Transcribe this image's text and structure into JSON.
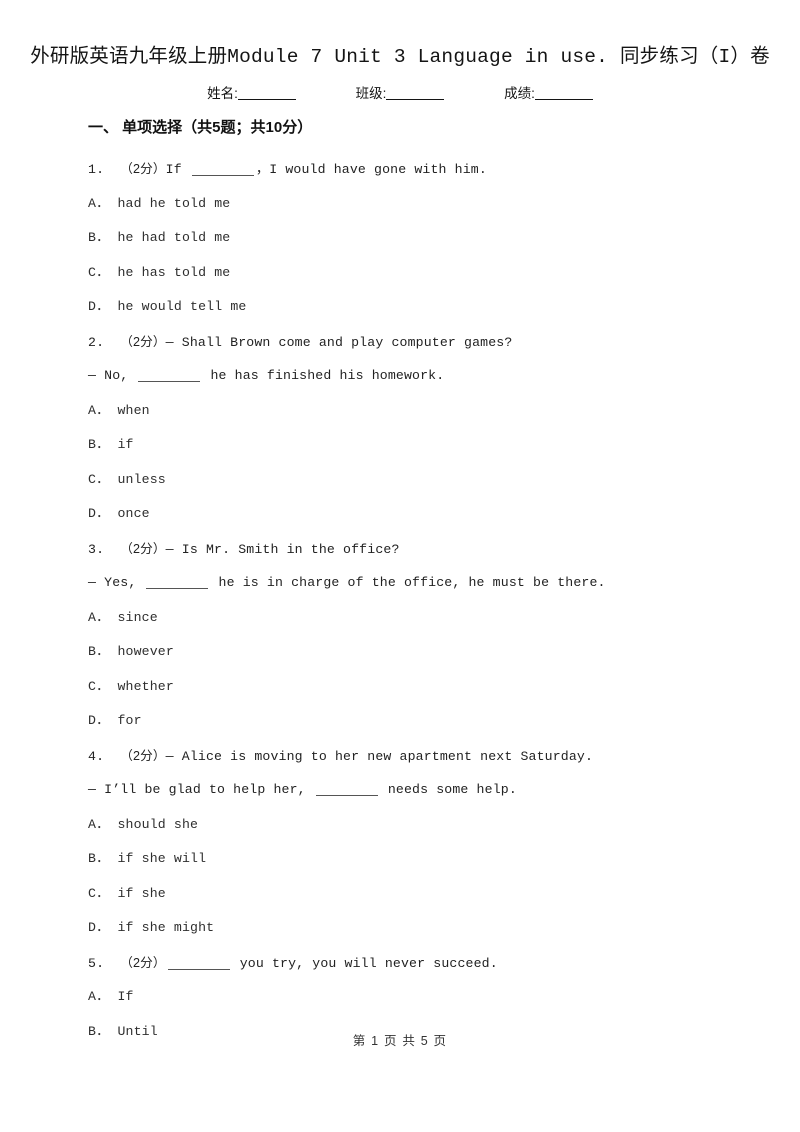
{
  "document": {
    "title": "外研版英语九年级上册Module 7 Unit 3 Language in use. 同步练习（I）卷",
    "meta": {
      "name_label": "姓名:",
      "class_label": "班级:",
      "score_label": "成绩:"
    },
    "footer": "第 1 页 共 5 页"
  },
  "section": {
    "header": "一、 单项选择（共5题；共10分）"
  },
  "questions": [
    {
      "number": "1.",
      "points": "（2分）",
      "stem_lines": [
        {
          "text_before": "If ",
          "blank": true,
          "text_after": "，I would have gone with him."
        }
      ],
      "options": [
        {
          "label": "A．",
          "text": "had he told me"
        },
        {
          "label": "B．",
          "text": "he had told me"
        },
        {
          "label": "C．",
          "text": "he has told me"
        },
        {
          "label": "D．",
          "text": "he would tell me"
        }
      ]
    },
    {
      "number": "2.",
      "points": "（2分）",
      "stem_lines": [
        {
          "text_before": "— Shall Brown come and play computer games?",
          "blank": false,
          "text_after": ""
        },
        {
          "text_before": "— No, ",
          "blank": true,
          "text_after": " he has finished his homework."
        }
      ],
      "options": [
        {
          "label": "A．",
          "text": "when"
        },
        {
          "label": "B．",
          "text": "if"
        },
        {
          "label": "C．",
          "text": "unless"
        },
        {
          "label": "D．",
          "text": "once"
        }
      ]
    },
    {
      "number": "3.",
      "points": "（2分）",
      "stem_lines": [
        {
          "text_before": "— Is Mr. Smith in the office?",
          "blank": false,
          "text_after": ""
        },
        {
          "text_before": "— Yes, ",
          "blank": true,
          "text_after": " he is in charge of the office, he must be there."
        }
      ],
      "options": [
        {
          "label": "A．",
          "text": "since"
        },
        {
          "label": "B．",
          "text": "however"
        },
        {
          "label": "C．",
          "text": "whether"
        },
        {
          "label": "D．",
          "text": "for"
        }
      ]
    },
    {
      "number": "4.",
      "points": "（2分）",
      "stem_lines": [
        {
          "text_before": "— Alice is moving to her new apartment next Saturday.",
          "blank": false,
          "text_after": ""
        },
        {
          "text_before": "— I’ll be glad to help her, ",
          "blank": true,
          "text_after": " needs some help."
        }
      ],
      "options": [
        {
          "label": "A．",
          "text": "should she"
        },
        {
          "label": "B．",
          "text": "if she will"
        },
        {
          "label": "C．",
          "text": "if she"
        },
        {
          "label": "D．",
          "text": "if she might"
        }
      ]
    },
    {
      "number": "5.",
      "points": "（2分）",
      "stem_lines": [
        {
          "text_before": "",
          "blank": true,
          "text_after": " you try, you will never succeed."
        }
      ],
      "options": [
        {
          "label": "A．",
          "text": "If"
        },
        {
          "label": "B．",
          "text": "Until"
        }
      ]
    }
  ]
}
